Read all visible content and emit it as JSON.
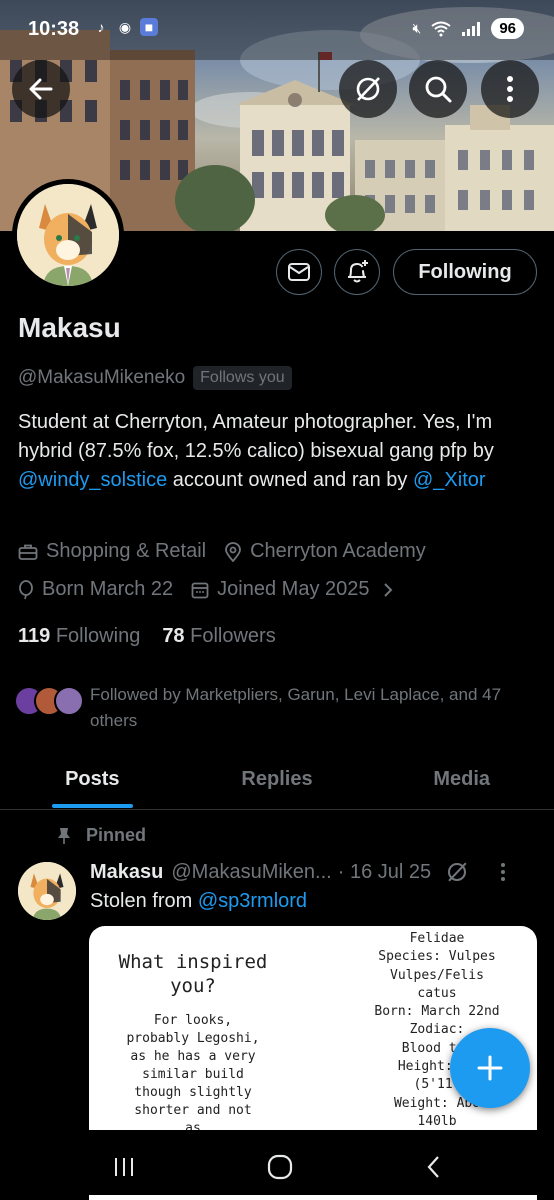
{
  "status_bar": {
    "time": "10:38",
    "battery": "96",
    "apps": [
      "tiktok-icon",
      "discord-icon",
      "game-icon"
    ]
  },
  "header": {
    "back": "back-arrow-icon",
    "grok": "grok-icon",
    "search": "search-icon",
    "more": "more-vertical-icon"
  },
  "profile": {
    "name": "Makasu",
    "handle": "@MakasuMikeneko",
    "follows_you": "Follows you",
    "follow_button": "Following",
    "bio": {
      "line1": "Student at Cherryton, Amateur photographer.  Yes, I'm hybrid (87.5% fox, 12.5% calico) bisexual gang pfp by ",
      "mention1": "@windy_solstice",
      "line2": " account owned and ran by ",
      "mention2": "@_Xitor"
    },
    "category": "Shopping & Retail",
    "location": "Cherryton Academy",
    "born": "Born March 22",
    "joined": "Joined May 2025",
    "following_count": "119",
    "following_label": "Following",
    "followers_count": "78",
    "followers_label": "Followers",
    "followed_by": "Followed by Marketpliers, Garun, Levi Laplace, and 47 others"
  },
  "tabs": [
    "Posts",
    "Replies",
    "Media"
  ],
  "post": {
    "pinned_label": "Pinned",
    "name": "Makasu",
    "handle": "@MakasuMiken...",
    "date": "· 16 Jul 25",
    "text": "Stolen from ",
    "mention": "@sp3rmlord",
    "image": {
      "question_line1": "What inspired",
      "question_line2": "you?",
      "answer": [
        "For looks,",
        "probably Legoshi,",
        "as he has a very",
        "similar build",
        "though slightly",
        "shorter and not",
        "as"
      ],
      "right": [
        "Felidae",
        "Species: Vulpes",
        "Vulpes/Felis",
        "catus",
        "Born: March 22nd",
        "Zodiac:",
        "Blood typ",
        "Height: 18",
        "(5'11\"",
        "Weight: Abo",
        "140lb"
      ]
    }
  },
  "colors": {
    "accent": "#1d9bf0",
    "muted": "#71767b",
    "text": "#e7e9ea",
    "border": "#536471"
  }
}
